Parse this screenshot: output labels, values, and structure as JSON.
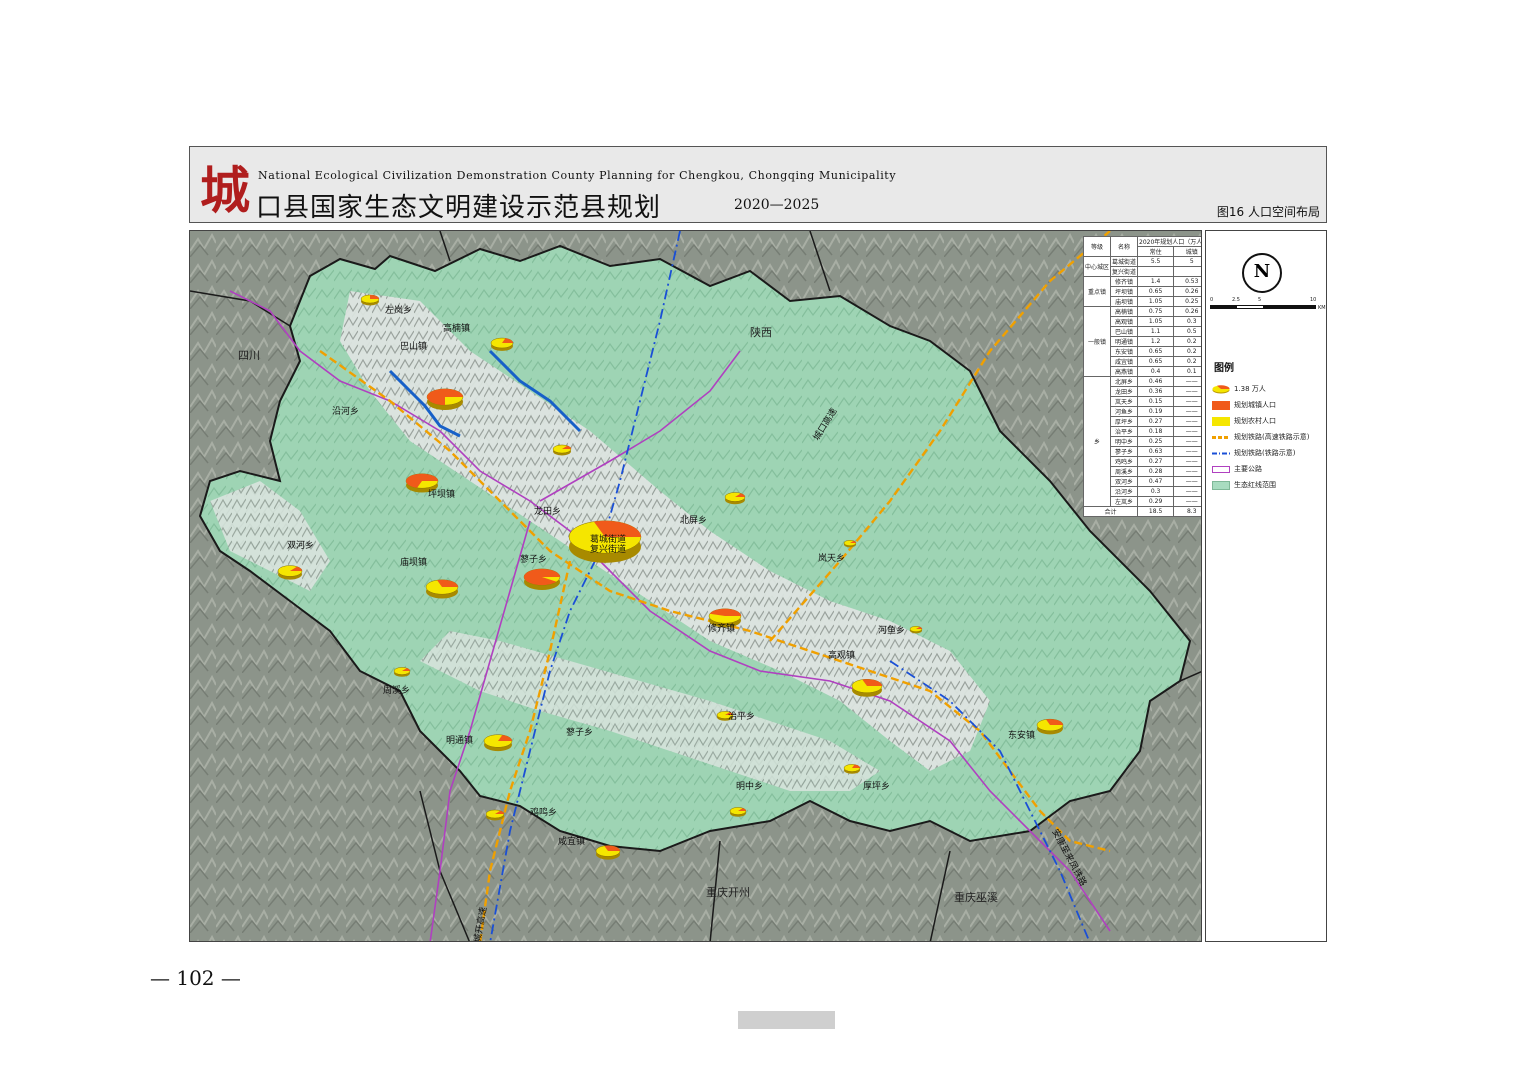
{
  "header": {
    "logo_char": "城",
    "subtitle_en": "National Ecological Civilization Demonstration County Planning for Chengkou, Chongqing Municipality",
    "title_zh": "口县国家生态文明建设示范县规划",
    "years": "2020—2025",
    "figure_label": "图16  人口空间布局"
  },
  "map": {
    "neighbor_regions": [
      "四川",
      "陕西",
      "重庆开州",
      "重庆巫溪"
    ],
    "towns": [
      {
        "name": "左岚乡"
      },
      {
        "name": "高楠镇"
      },
      {
        "name": "巴山镇"
      },
      {
        "name": "沿河乡"
      },
      {
        "name": "坪坝镇"
      },
      {
        "name": "龙田乡"
      },
      {
        "name": "北屏乡"
      },
      {
        "name": "双河乡"
      },
      {
        "name": "庙坝镇"
      },
      {
        "name": "葛城街道"
      },
      {
        "name": "复兴街道"
      },
      {
        "name": "蓼子乡"
      },
      {
        "name": "岚天乡"
      },
      {
        "name": "修齐镇"
      },
      {
        "name": "河鱼乡"
      },
      {
        "name": "高观镇"
      },
      {
        "name": "周溪乡"
      },
      {
        "name": "蓼子乡"
      },
      {
        "name": "治平乡"
      },
      {
        "name": "明通镇"
      },
      {
        "name": "东安镇"
      },
      {
        "name": "明中乡"
      },
      {
        "name": "厚坪乡"
      },
      {
        "name": "鸡鸣乡"
      },
      {
        "name": "咸宜镇"
      }
    ],
    "route_labels": [
      "城口高速",
      "安康至来凤铁路",
      "城开高速"
    ],
    "pies": [
      {
        "town": "左岚乡",
        "urban_share": 0.25
      },
      {
        "town": "高楠镇",
        "urban_share": 0.2
      },
      {
        "town": "巴山镇",
        "urban_share": 0.75
      },
      {
        "town": "坪坝镇",
        "urban_share": 0.7
      },
      {
        "town": "北屏乡",
        "urban_share": 0.15
      },
      {
        "town": "双河乡",
        "urban_share": 0.15
      },
      {
        "town": "庙坝镇",
        "urban_share": 0.3
      },
      {
        "town": "葛城街道",
        "urban_share": 0.9
      },
      {
        "town": "蓼子乡",
        "urban_share": 0.3
      },
      {
        "town": "修齐镇",
        "urban_share": 0.45
      },
      {
        "town": "高观镇",
        "urban_share": 0.3
      },
      {
        "town": "周溪乡",
        "urban_share": 0.15
      },
      {
        "town": "东安镇",
        "urban_share": 0.3
      },
      {
        "town": "明通镇",
        "urban_share": 0.2
      },
      {
        "town": "治平乡",
        "urban_share": 0.15
      },
      {
        "town": "鸡鸣乡",
        "urban_share": 0.15
      },
      {
        "town": "咸宜镇",
        "urban_share": 0.3
      },
      {
        "town": "厚坪乡",
        "urban_share": 0.2
      },
      {
        "town": "明中乡",
        "urban_share": 0.15
      },
      {
        "town": "岚天乡",
        "urban_share": 0.15
      },
      {
        "town": "河鱼乡",
        "urban_share": 0.15
      },
      {
        "town": "龙田乡",
        "urban_share": 0.15
      }
    ]
  },
  "table": {
    "headers": {
      "level": "等级",
      "name": "名称",
      "pop_2020": "2020年规划人口（万人）",
      "urban": "常住",
      "town": "城镇"
    },
    "groups": [
      {
        "level": "中心城区",
        "rows": [
          [
            "葛城街道",
            "5.5",
            "5"
          ],
          [
            "复兴街道",
            "",
            ""
          ]
        ]
      },
      {
        "level": "重点镇",
        "rows": [
          [
            "修齐镇",
            "1.4",
            "0.53"
          ],
          [
            "坪坝镇",
            "0.65",
            "0.26"
          ],
          [
            "庙坝镇",
            "1.05",
            "0.25"
          ]
        ]
      },
      {
        "level": "一般镇",
        "rows": [
          [
            "高楠镇",
            "0.75",
            "0.26"
          ],
          [
            "高观镇",
            "1.05",
            "0.3"
          ],
          [
            "巴山镇",
            "1.1",
            "0.5"
          ],
          [
            "明通镇",
            "1.2",
            "0.2"
          ],
          [
            "东安镇",
            "0.65",
            "0.2"
          ],
          [
            "咸宜镇",
            "0.65",
            "0.2"
          ],
          [
            "高燕镇",
            "0.4",
            "0.1"
          ]
        ]
      },
      {
        "level": "乡",
        "rows": [
          [
            "北屏乡",
            "0.46",
            "——"
          ],
          [
            "龙田乡",
            "0.36",
            "——"
          ],
          [
            "岚天乡",
            "0.15",
            "——"
          ],
          [
            "河鱼乡",
            "0.19",
            "——"
          ],
          [
            "厚坪乡",
            "0.27",
            "——"
          ],
          [
            "治平乡",
            "0.18",
            "——"
          ],
          [
            "明中乡",
            "0.25",
            "——"
          ],
          [
            "蓼子乡",
            "0.63",
            "——"
          ],
          [
            "鸡鸣乡",
            "0.27",
            "——"
          ],
          [
            "周溪乡",
            "0.28",
            "——"
          ],
          [
            "双河乡",
            "0.47",
            "——"
          ],
          [
            "沿河乡",
            "0.3",
            "——"
          ],
          [
            "左岚乡",
            "0.29",
            "——"
          ]
        ]
      }
    ],
    "total": [
      "合计",
      "18.5",
      "8.3"
    ]
  },
  "legend": {
    "scale_labels": [
      "0",
      "2.5",
      "5",
      "10"
    ],
    "scale_unit": "KM",
    "north_letter": "N",
    "title": "图例",
    "items": [
      {
        "label": "1.38 万人",
        "symbol": "pie"
      },
      {
        "label": "规划城镇人口",
        "symbol": "urban",
        "color": "#f05a1a"
      },
      {
        "label": "规划农村人口",
        "symbol": "rural",
        "color": "#f5e600"
      },
      {
        "label": "规划铁路(高速铁路示意)",
        "symbol": "rail-hsr",
        "color": "#f0a000"
      },
      {
        "label": "规划铁路(铁路示意)",
        "symbol": "rail",
        "color": "#1a4fd6"
      },
      {
        "label": "主要公路",
        "symbol": "road",
        "color": "#b040c0"
      },
      {
        "label": "生态红线范围",
        "symbol": "eco",
        "color": "#a8dcc0"
      }
    ]
  },
  "footer": {
    "page_number": "— 102 —"
  }
}
